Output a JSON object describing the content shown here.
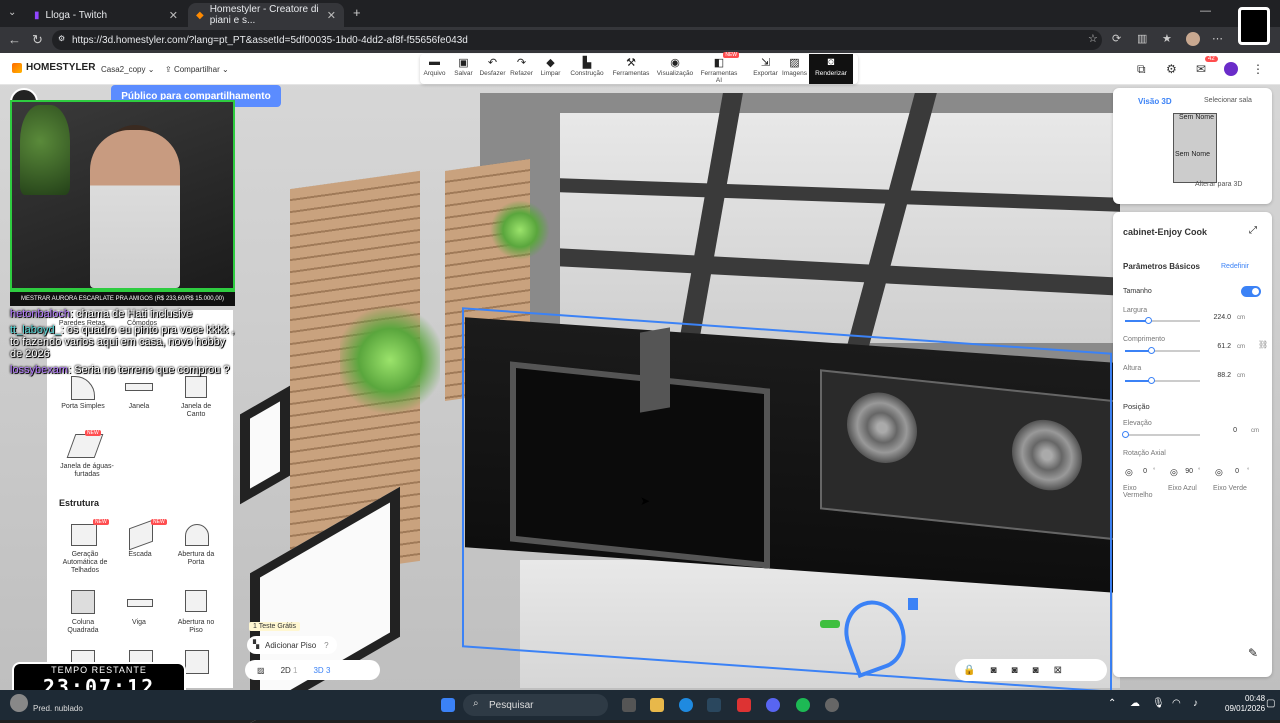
{
  "browser": {
    "tabs": [
      {
        "label": "Lloga - Twitch"
      },
      {
        "label": "Homestyler - Creatore di piani e s..."
      }
    ],
    "url": "https://3d.homestyler.com/?lang=pt_PT&assetId=5df00035-1bd0-4dd2-af8f-f55656fe043d"
  },
  "app": {
    "logo": "HOMESTYLER",
    "project_name": "Casa2_copy",
    "share_label": "Compartilhar",
    "publish_tooltip": "Público para compartilhamento",
    "notification_count": "42",
    "toolbar": [
      {
        "label": "Arquivo",
        "icon": "folder-icon"
      },
      {
        "label": "Salvar",
        "icon": "save-icon"
      },
      {
        "label": "Desfazer",
        "icon": "undo-icon"
      },
      {
        "label": "Refazer",
        "icon": "redo-icon"
      },
      {
        "label": "Limpar",
        "icon": "eraser-icon"
      },
      {
        "label": "Construção",
        "icon": "build-icon"
      },
      {
        "label": "Ferramentas",
        "icon": "tools-icon"
      },
      {
        "label": "Visualização",
        "icon": "eye-icon"
      },
      {
        "label": "Ferramentas AI",
        "icon": "ai-icon",
        "badge": "NEW"
      },
      {
        "label": "Exportar",
        "icon": "export-icon"
      },
      {
        "label": "Imagens",
        "icon": "image-icon"
      },
      {
        "label": "Renderizar",
        "icon": "camera-icon"
      }
    ]
  },
  "left_panel": {
    "row1": [
      "Paredes Retas",
      "Cômodos"
    ],
    "row2": [
      "Porta Simples",
      "Janela",
      "Janela de Canto"
    ],
    "row3": [
      "Janela de águas-furtadas"
    ],
    "section_structure": "Estrutura",
    "row4": [
      "Geração Automática de Telhados",
      "Escada",
      "Abertura da Porta"
    ],
    "row5": [
      "Coluna Quadrada",
      "Viga",
      "Abertura no Piso"
    ],
    "new_badge": "NEW"
  },
  "stream": {
    "donation": "MESTRAR AURORA ESCARLATE PRA AMIGOS (R$ 233,60/R$ 15.000,00)",
    "chat": [
      {
        "user": "hetonbaloch",
        "text": "chama de Hati inclusive"
      },
      {
        "user": "tt_laboyd_",
        "text": "os quadro eu pinto pra voce kkkk , to fazendo varios aqui em casa, novo hobby de 2026"
      },
      {
        "user": "lossybexam",
        "text": "Seria no terreno que comprou ?"
      }
    ],
    "timer_label": "TEMPO RESTANTE",
    "timer_value": "23:07:12"
  },
  "minimap": {
    "tab_3d": "Visão 3D",
    "tab_room": "Selecionar sala",
    "room_label_1": "Sem Nome",
    "room_label_2": "Sem Nome",
    "switch_3d": "Alterar para 3D"
  },
  "properties": {
    "title": "cabinet-Enjoy Cook",
    "section_basic": "Parâmetros Básicos",
    "reset": "Redefinir",
    "size_label": "Tamanho",
    "width_label": "Largura",
    "width_value": "224.0",
    "length_label": "Comprimento",
    "length_value": "61.2",
    "height_label": "Altura",
    "height_value": "88.2",
    "unit": "cm",
    "position_label": "Posição",
    "elevation_label": "Elevação",
    "elevation_value": "0",
    "rotation_label": "Rotação Axial",
    "rot_red_value": "0",
    "rot_blue_value": "90",
    "rot_green_value": "0",
    "deg": "°",
    "axis_red": "Eixo Vermelho",
    "axis_blue": "Eixo Azul",
    "axis_green": "Eixo Verde",
    "width_fraction": 0.3,
    "length_fraction": 0.35,
    "height_fraction": 0.35,
    "elevation_fraction": 0
  },
  "bottom": {
    "trial": "1 Teste Grátis",
    "add_floor": "Adicionar Piso",
    "view_2d": "2D",
    "view_3d": "3D",
    "view_2d_key": "1",
    "view_3d_key": "3"
  },
  "taskbar": {
    "weather": "Pred. nublado",
    "search": "Pesquisar",
    "time": "00:48",
    "date": "09/01/2026"
  },
  "colors": {
    "accent": "#3b82f6",
    "badge": "#ff4d4f",
    "publish": "#5b8cff"
  }
}
